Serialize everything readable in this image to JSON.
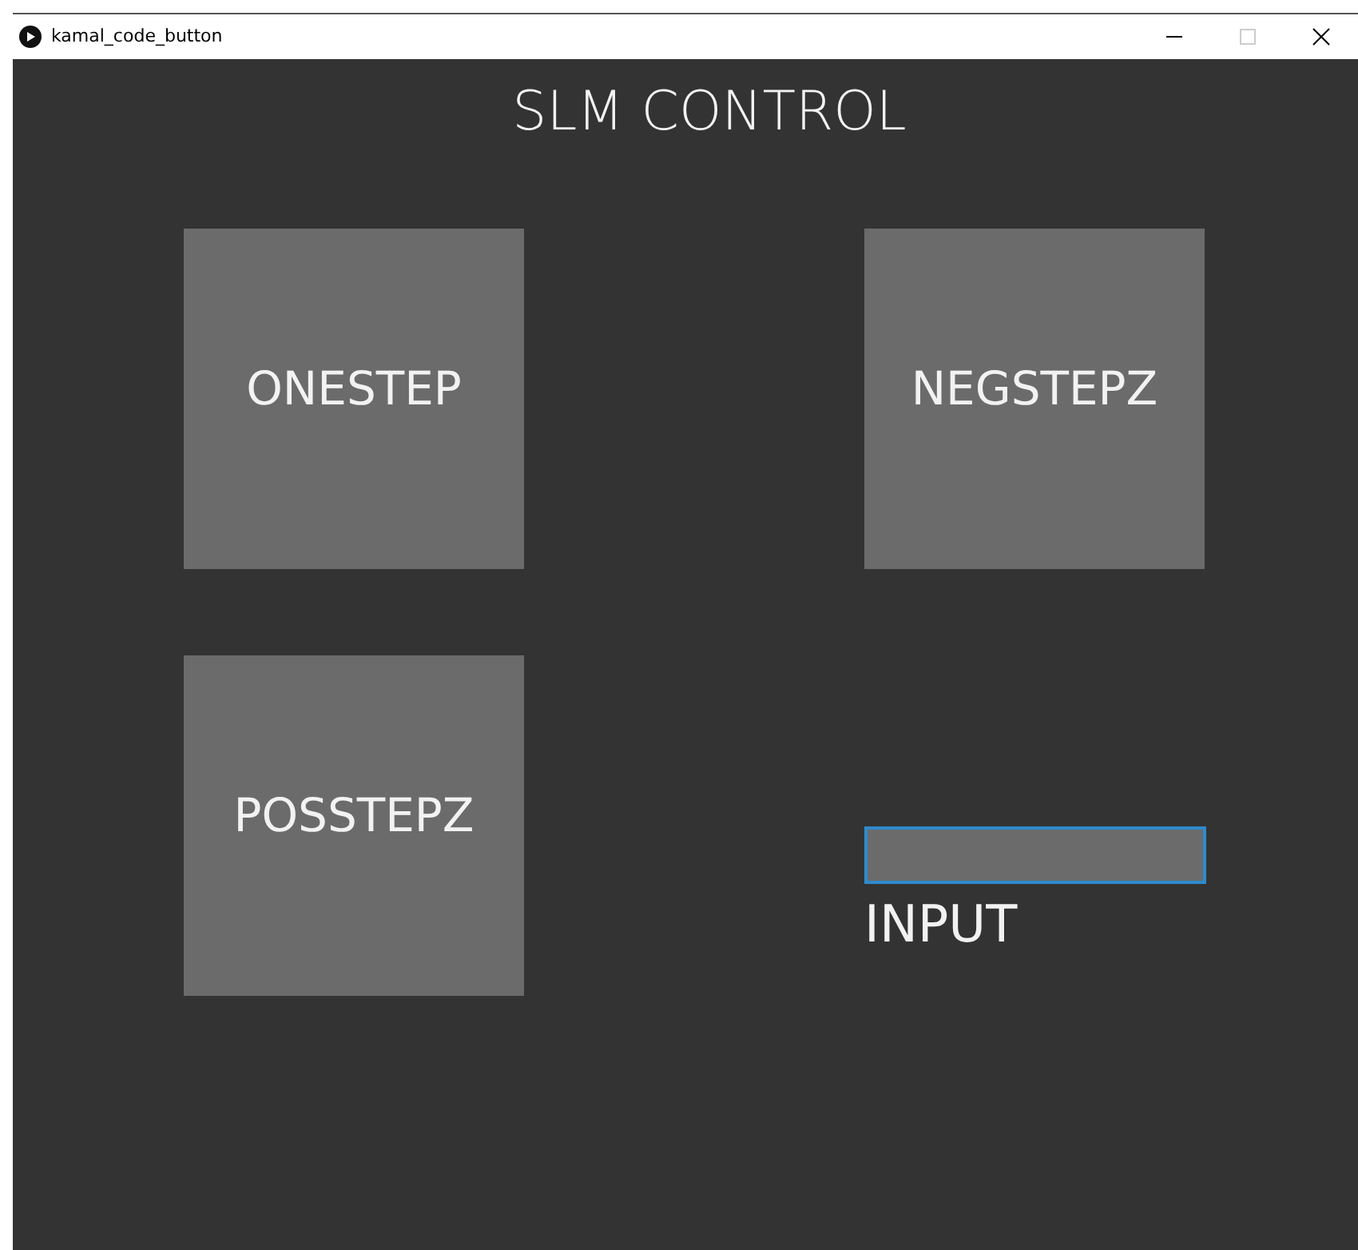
{
  "window": {
    "title": "kamal_code_button",
    "controls": [
      {
        "kind": "minimize",
        "disabled": false
      },
      {
        "kind": "maximize",
        "disabled": true
      },
      {
        "kind": "close",
        "disabled": false
      }
    ]
  },
  "heading": "SLM CONTROL",
  "buttons": [
    {
      "label": "ONESTEP"
    },
    {
      "label": "NEGSTEPZ"
    },
    {
      "label": "POSSTEPZ"
    }
  ],
  "input": {
    "label": "INPUT",
    "focused": true
  }
}
